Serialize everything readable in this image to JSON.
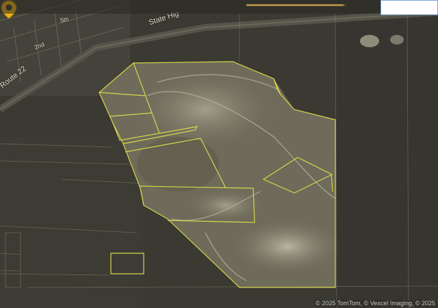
{
  "map": {
    "labels": {
      "route": "Route 22",
      "state_highway": "State Hig",
      "street_1": "5th",
      "street_2": "2nd"
    },
    "attribution": "© 2025 TomTom, © Vexcel Imaging, © 2025",
    "loading_progress": 0.97,
    "colors": {
      "parcel_outline": "#d8d64a",
      "pin": "#f2b418",
      "terrain_dark": "#3b3a33",
      "terrain_light": "#8f8b7a"
    },
    "icons": {
      "location_pin": "map-pin-icon"
    }
  }
}
